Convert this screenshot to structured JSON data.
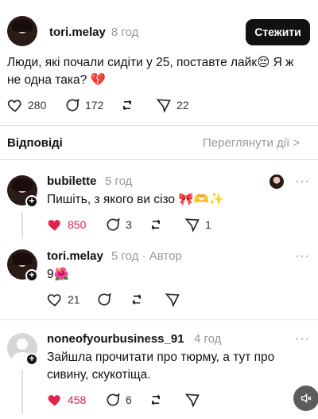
{
  "post": {
    "username": "tori.melay",
    "time": "8 год",
    "follow_label": "Стежити",
    "text_line1": "Люди, які почали сидіти у 25, поставте лайк😔 Я ж",
    "text_line2": "не одна така? 💔",
    "likes": "280",
    "comments": "172",
    "shares": "22"
  },
  "replies_header": {
    "title": "Відповіді",
    "view_activity": "Переглянути дії >"
  },
  "replies": [
    {
      "username": "bubilette",
      "time": "5 год",
      "text": "Пишіть, з якого ви сізо 🎀🫶✨",
      "likes": "850",
      "comments": "3",
      "shares": "1"
    },
    {
      "username": "tori.melay",
      "time": "5 год · Автор",
      "text": "9🌺",
      "likes": "21"
    },
    {
      "username": "noneofyourbusiness_91",
      "time": "4 год",
      "text_line1": "Зайшла прочитати про тюрму, а тут про",
      "text_line2": "сивину, скукотіща.",
      "likes": "458",
      "comments": "6"
    }
  ],
  "icons": {
    "heart": "heart-icon",
    "comment": "comment-icon",
    "repost": "repost-icon",
    "share": "send-icon",
    "more": "more-icon",
    "mute": "mute-icon"
  },
  "colors": {
    "like_red": "#e0244b",
    "muted": "#999999",
    "button_bg": "#111111"
  }
}
